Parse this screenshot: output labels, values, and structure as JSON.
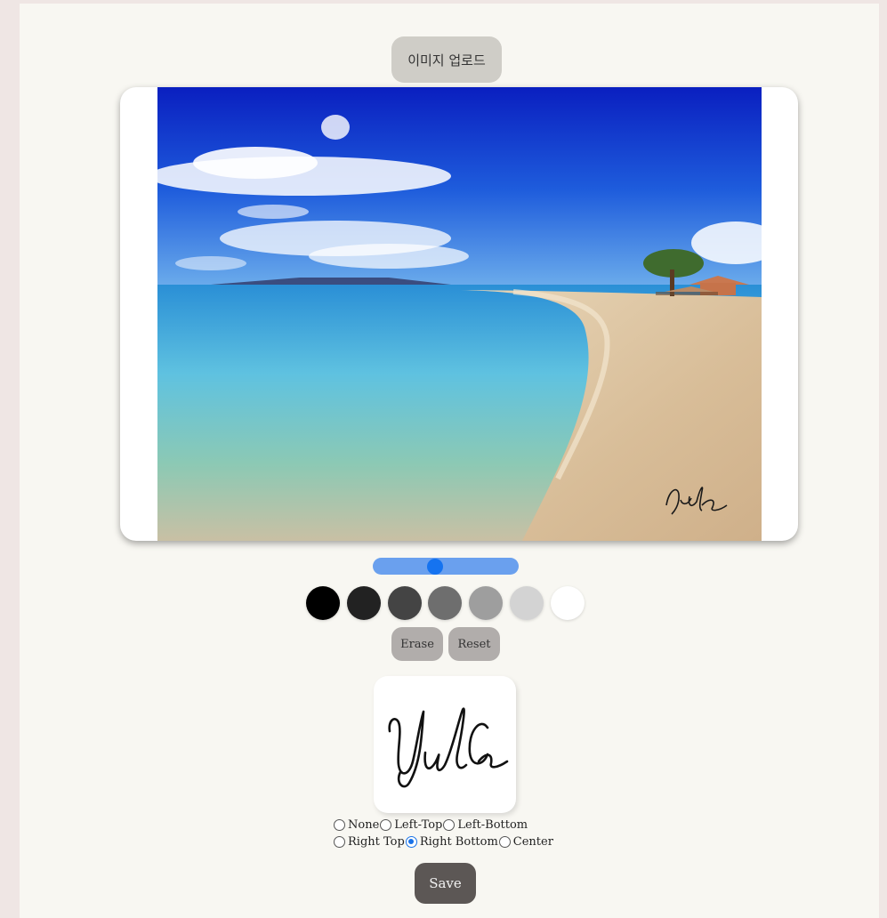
{
  "upload": {
    "label": "이미지 업로드"
  },
  "image": {
    "description_icon": "beach-photo",
    "watermark_text": "Yula"
  },
  "slider": {
    "value_fraction": 0.42,
    "color": "#6aa0ee",
    "thumb_color": "#1573f0"
  },
  "colors": [
    "#000000",
    "#222222",
    "#444444",
    "#6e6e6e",
    "#9e9e9e",
    "#d3d3d3",
    "#ffffff"
  ],
  "buttons": {
    "erase": "Erase",
    "reset": "Reset",
    "save": "Save"
  },
  "signature": {
    "text": "Yula"
  },
  "position_options": {
    "row1": [
      "None",
      "Left-Top",
      "Left-Bottom"
    ],
    "row2": [
      "Right Top",
      "Right Bottom",
      "Center"
    ],
    "selected": "Right Bottom"
  }
}
